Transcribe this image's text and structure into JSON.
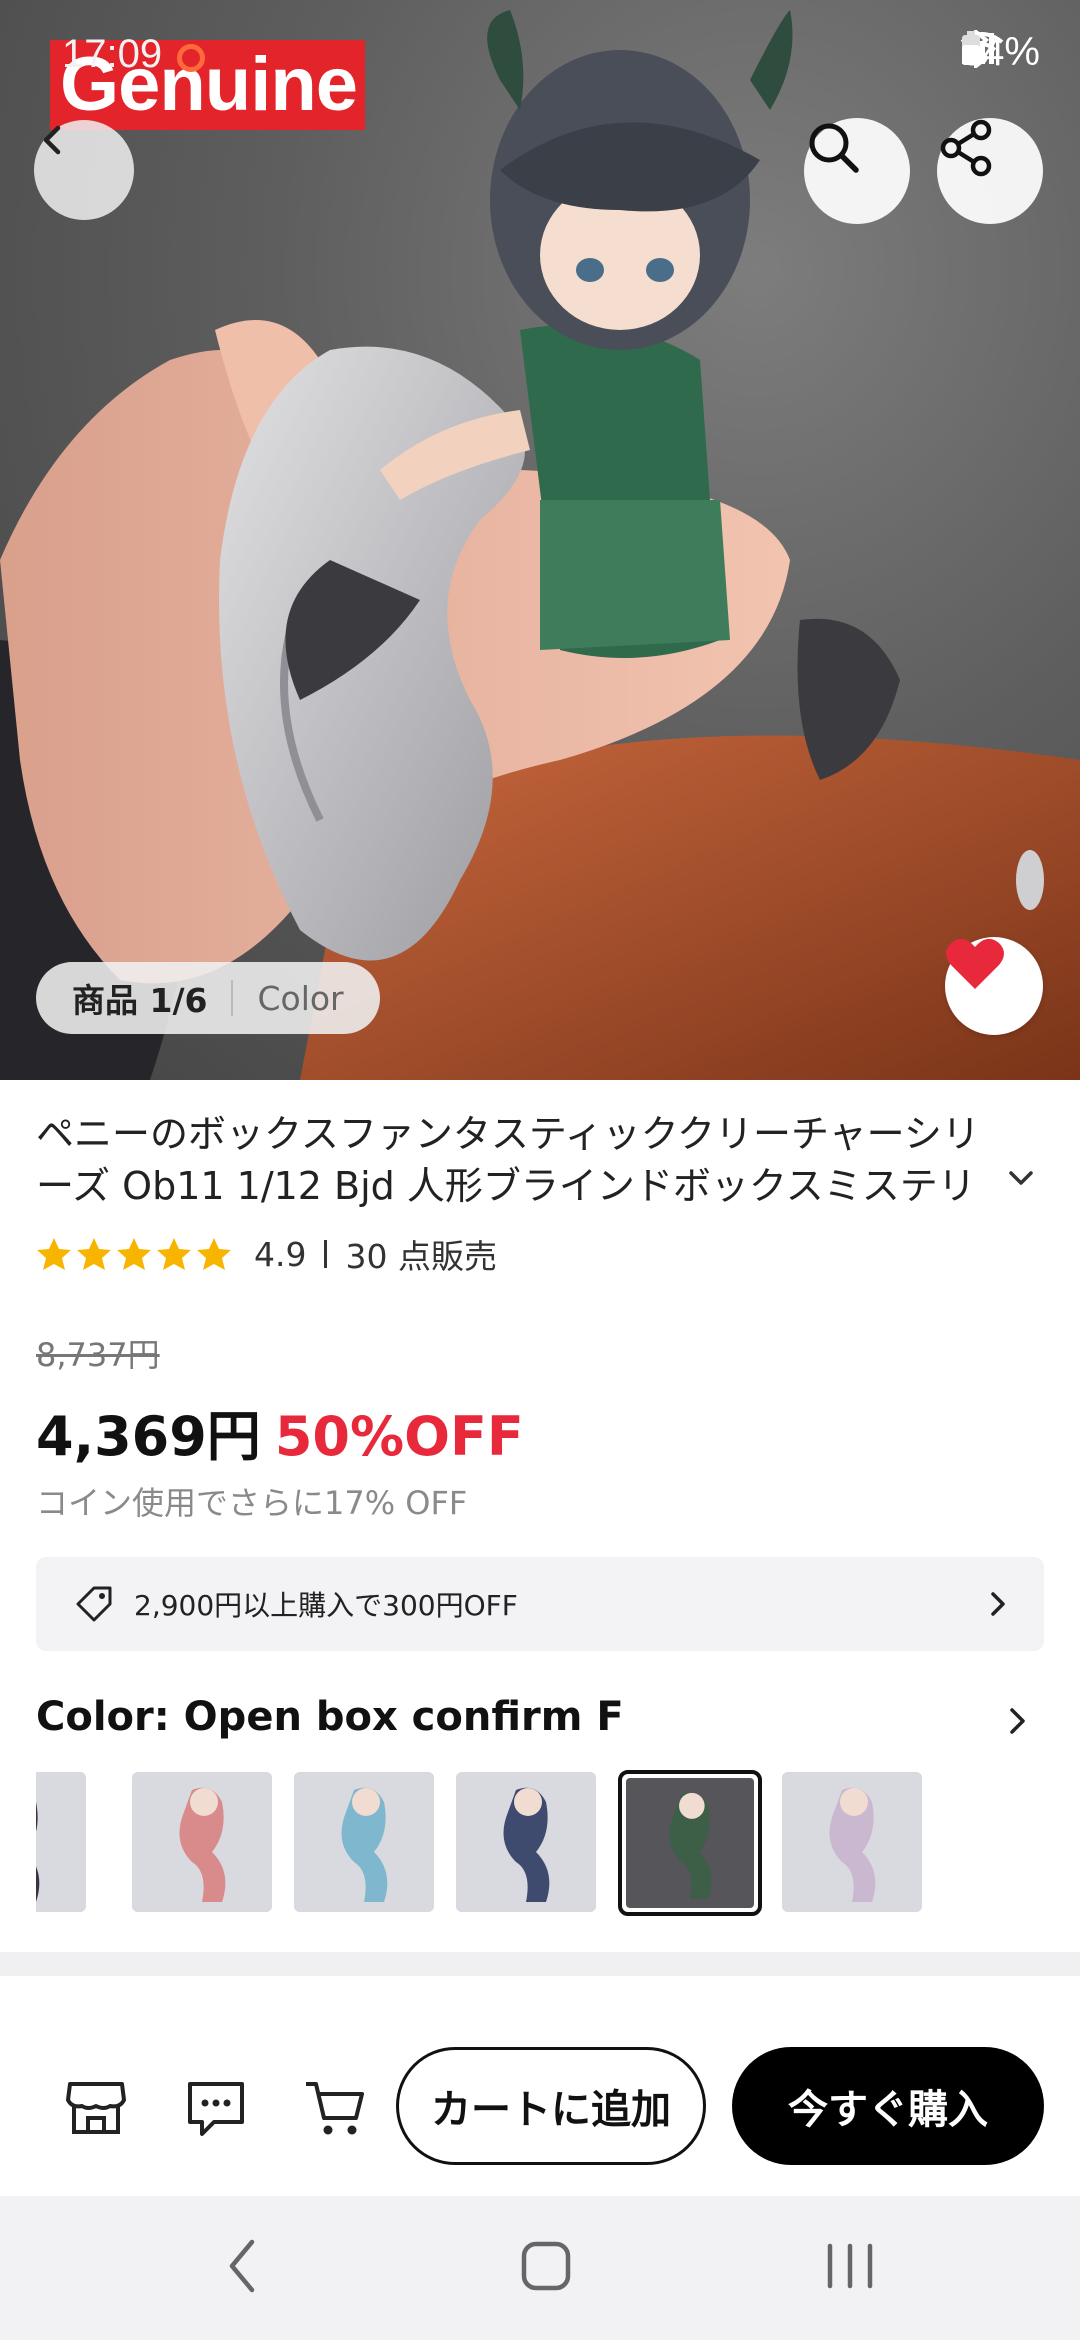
{
  "status_bar": {
    "time": "17:09",
    "battery": "64%"
  },
  "hero": {
    "badge_text": "Genuine",
    "counter_label": "商品 1/6",
    "category_label": "Color"
  },
  "product": {
    "title_line1": "ペニーのボックスファンタスティッククリーチャーシリ",
    "title_line2": "ーズ Ob11 1/12 Bjd 人形ブラインドボックスミステリ",
    "rating": "4.9",
    "star_count": 5,
    "sold": "30 点販売",
    "original_price": "8,737円",
    "price": "4,369円",
    "discount": "50%OFF",
    "coin_note": "コイン使用でさらに17% OFF",
    "coupon_text": "2,900円以上購入で300円OFF"
  },
  "color_section": {
    "label": "Color: Open box confirm F",
    "swatches": [
      {
        "name": "swatch-1",
        "tint": "#3a3240",
        "selected": false
      },
      {
        "name": "swatch-2",
        "tint": "#d98a8a",
        "selected": false
      },
      {
        "name": "swatch-3",
        "tint": "#7fb7cf",
        "selected": false
      },
      {
        "name": "swatch-4",
        "tint": "#3e4a6e",
        "selected": false
      },
      {
        "name": "swatch-5",
        "tint": "#3d5e47",
        "selected": true
      },
      {
        "name": "swatch-6",
        "tint": "#c9b8cf",
        "selected": false
      }
    ]
  },
  "actions": {
    "add_to_cart": "カートに追加",
    "buy_now": "今すぐ購入"
  },
  "colors": {
    "accent_red": "#e8283b",
    "star": "#f7b500",
    "black": "#000000"
  }
}
